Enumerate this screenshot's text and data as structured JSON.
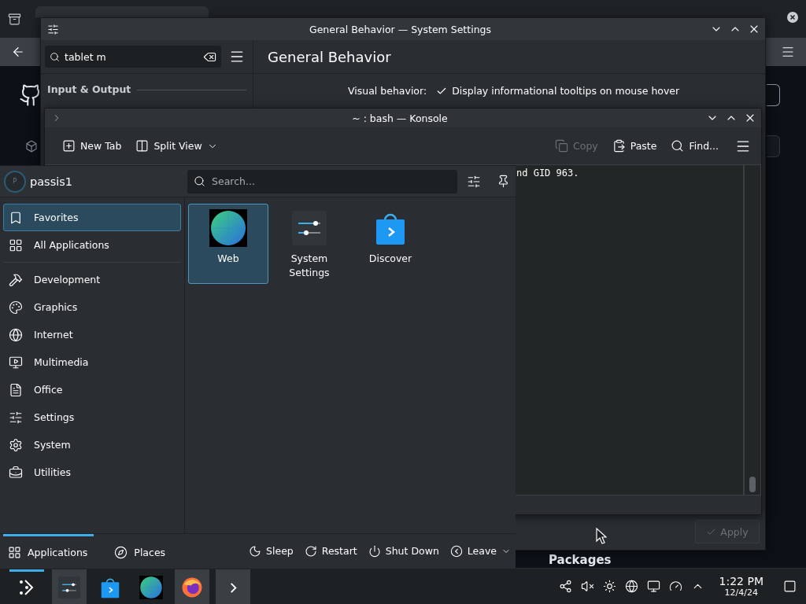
{
  "browser": {
    "heading": "Packages"
  },
  "settings_window": {
    "title": "General Behavior — System Settings",
    "search": {
      "value": "tablet m"
    },
    "page_title": "General Behavior",
    "sidebar_section": "Input & Output",
    "option": {
      "label": "Visual behavior:",
      "text": "Display informational tooltips on mouse hover",
      "checked": true
    },
    "apply_button": {
      "label": "Apply",
      "disabled": true
    }
  },
  "konsole": {
    "title": "~ : bash — Konsole",
    "toolbar_left": [
      {
        "kind": "new-tab",
        "label": "New Tab",
        "disabled": false
      },
      {
        "kind": "split",
        "label": "Split View",
        "disabled": false
      }
    ],
    "toolbar_right": [
      {
        "kind": "copy",
        "label": "Copy",
        "disabled": true
      },
      {
        "kind": "paste",
        "label": "Paste",
        "disabled": false
      },
      {
        "kind": "find",
        "label": "Find...",
        "disabled": false
      }
    ],
    "output": "nd GID 963."
  },
  "launcher": {
    "user": "passis1",
    "avatar_letter": "P",
    "search": {
      "placeholder": "Search..."
    },
    "views": [
      {
        "kind": "favorites",
        "label": "Favorites",
        "selected": true
      },
      {
        "kind": "all",
        "label": "All Applications",
        "selected": false
      }
    ],
    "categories": [
      {
        "kind": "development",
        "label": "Development",
        "selected": false
      },
      {
        "kind": "graphics",
        "label": "Graphics",
        "selected": false
      },
      {
        "kind": "internet",
        "label": "Internet",
        "selected": false
      },
      {
        "kind": "multimedia",
        "label": "Multimedia",
        "selected": false
      },
      {
        "kind": "office",
        "label": "Office",
        "selected": false
      },
      {
        "kind": "settings",
        "label": "Settings",
        "selected": false
      },
      {
        "kind": "system",
        "label": "System",
        "selected": false
      },
      {
        "kind": "utilities",
        "label": "Utilities",
        "selected": false
      }
    ],
    "favorites": [
      {
        "kind": "web",
        "label": "Web",
        "selected": true
      },
      {
        "kind": "settings",
        "label": "System Settings",
        "selected": false
      },
      {
        "kind": "discover",
        "label": "Discover",
        "selected": false
      }
    ],
    "tabs": [
      {
        "kind": "applications",
        "label": "Applications",
        "selected": true
      },
      {
        "kind": "places",
        "label": "Places",
        "selected": false
      }
    ],
    "power": [
      {
        "kind": "sleep",
        "label": "Sleep"
      },
      {
        "kind": "restart",
        "label": "Restart"
      },
      {
        "kind": "shutdown",
        "label": "Shut Down"
      },
      {
        "kind": "leave",
        "label": "Leave"
      }
    ]
  },
  "taskbar": {
    "launcher_open": true,
    "tasks": [
      {
        "kind": "settings",
        "active": true
      },
      {
        "kind": "discover",
        "active": false
      },
      {
        "kind": "web",
        "active": false
      },
      {
        "kind": "firefox",
        "active": true
      },
      {
        "kind": "konsole",
        "active": true
      }
    ],
    "clock": {
      "time": "1:22 PM",
      "date": "12/4/24"
    }
  }
}
